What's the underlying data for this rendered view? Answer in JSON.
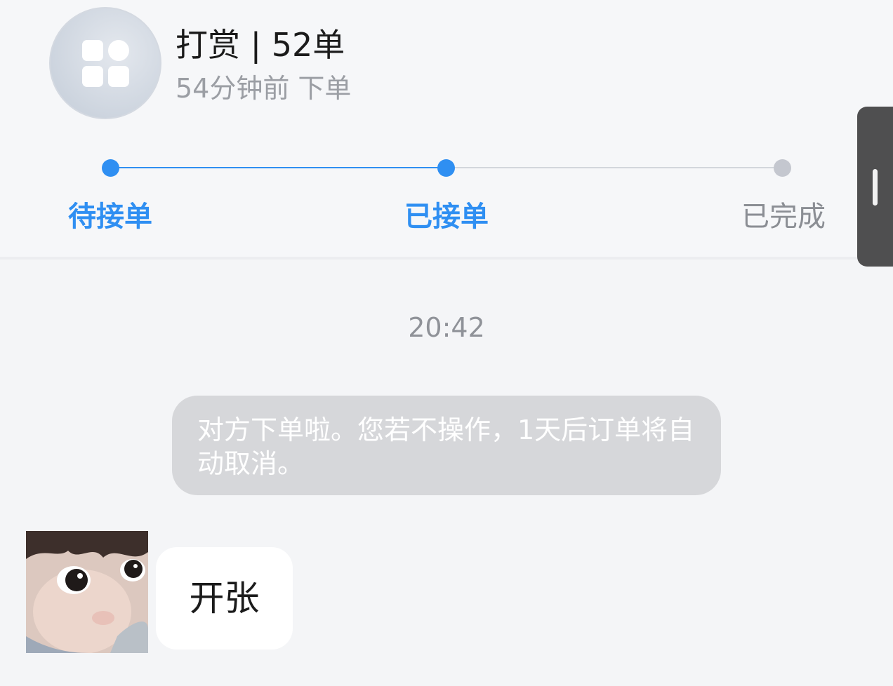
{
  "header": {
    "title": "打赏 | 52单",
    "subtitle": "54分钟前 下单",
    "icon": "app-grid-icon"
  },
  "progress": {
    "steps": [
      {
        "label": "待接单",
        "state": "done"
      },
      {
        "label": "已接单",
        "state": "current"
      },
      {
        "label": "已完成",
        "state": "pending"
      }
    ],
    "active_color": "#2f8ff2",
    "inactive_color": "#c4c7cf"
  },
  "chat": {
    "timestamp": "20:42",
    "system_message": "对方下单啦。您若不操作，1天后订单将自动取消。",
    "messages": [
      {
        "sender": "other",
        "avatar": "user-avatar",
        "text": "开张"
      }
    ]
  }
}
